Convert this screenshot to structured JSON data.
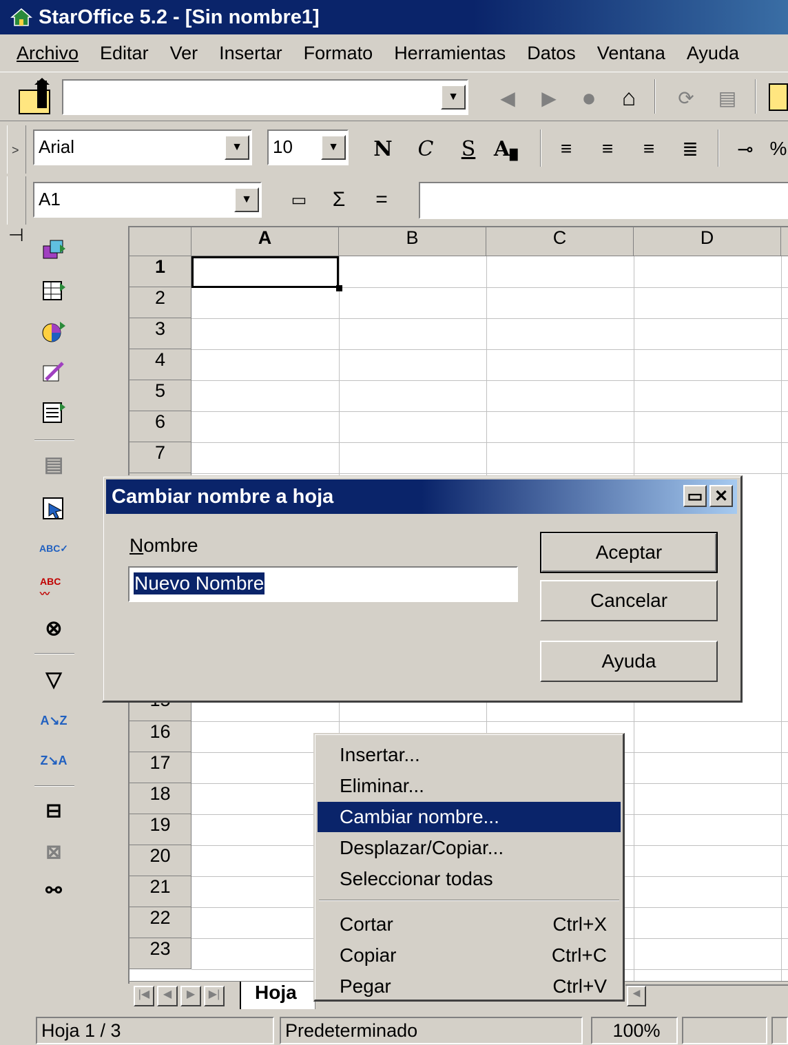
{
  "window": {
    "title": "StarOffice 5.2 - [Sin nombre1]",
    "app_icon": "staroffice-icon"
  },
  "menu": [
    "Archivo",
    "Editar",
    "Ver",
    "Insertar",
    "Formato",
    "Herramientas",
    "Datos",
    "Ventana",
    "Ayuda"
  ],
  "function_bar": {
    "url_value": ""
  },
  "object_bar": {
    "font_name": "Arial",
    "font_size": "10",
    "bold": "N",
    "italic": "C",
    "underline": "S"
  },
  "formula_bar": {
    "cell_ref": "A1",
    "sum_symbol": "Σ",
    "equals_symbol": "=",
    "content": ""
  },
  "sheet": {
    "columns": [
      "A",
      "B",
      "C",
      "D"
    ],
    "rows_top": [
      "1",
      "2",
      "3",
      "4",
      "5",
      "6",
      "7"
    ],
    "row_15_partial": "15",
    "rows_bottom": [
      "16",
      "17",
      "18",
      "19",
      "20",
      "21",
      "22",
      "23"
    ],
    "active_tab": "Hoja"
  },
  "dialog": {
    "title": "Cambiar nombre a hoja",
    "name_label": "Nombre",
    "name_value": "Nuevo Nombre",
    "ok": "Aceptar",
    "cancel": "Cancelar",
    "help": "Ayuda"
  },
  "context_menu": {
    "items": [
      "Insertar...",
      "Eliminar...",
      "Cambiar nombre...",
      "Desplazar/Copiar...",
      "Seleccionar todas"
    ],
    "edit_items": [
      {
        "label": "Cortar",
        "shortcut": "Ctrl+X"
      },
      {
        "label": "Copiar",
        "shortcut": "Ctrl+C"
      },
      {
        "label": "Pegar",
        "shortcut": "Ctrl+V"
      }
    ],
    "highlighted": "Cambiar nombre..."
  },
  "status_bar": {
    "sheet": "Hoja 1 / 3",
    "style": "Predeterminado",
    "zoom": "100%"
  },
  "colors": {
    "title_bar": "#0a246a",
    "face": "#d4d0c8",
    "selection": "#0a246a"
  }
}
